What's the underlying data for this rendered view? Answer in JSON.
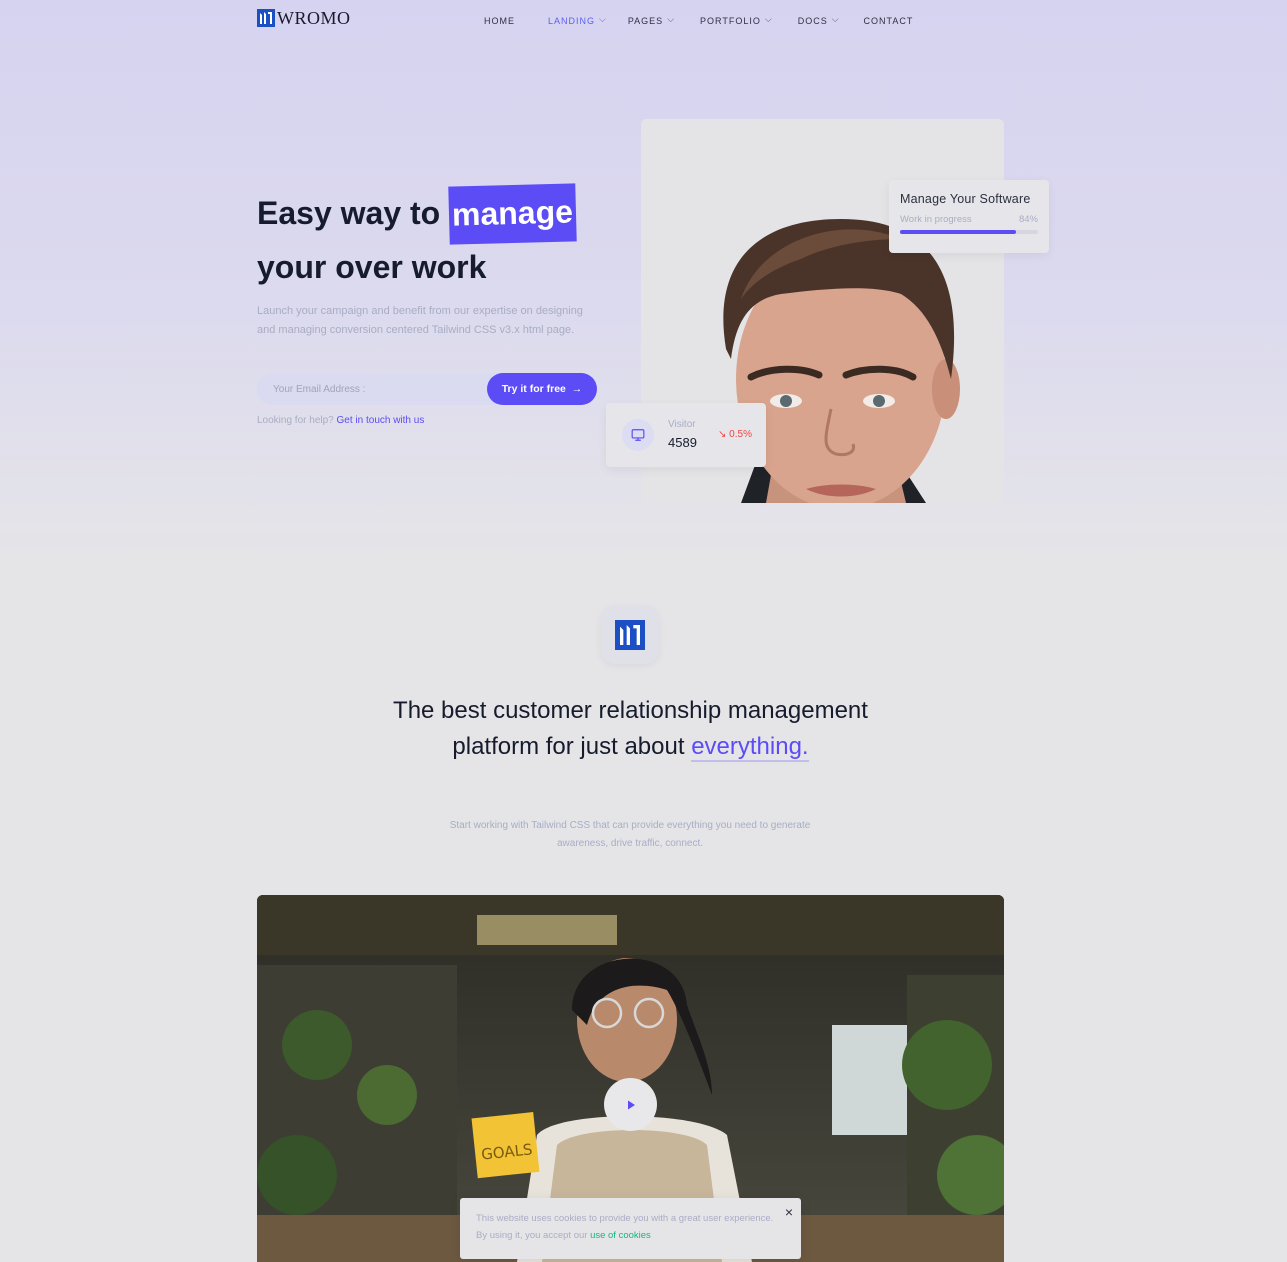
{
  "brand": {
    "name": "WROMO",
    "color": "#1d4fc4",
    "accent": "#5b4cf6"
  },
  "nav": [
    {
      "label": "HOME",
      "dropdown": false,
      "active": false
    },
    {
      "label": "LANDING",
      "dropdown": true,
      "active": true
    },
    {
      "label": "PAGES",
      "dropdown": true,
      "active": false
    },
    {
      "label": "PORTFOLIO",
      "dropdown": true,
      "active": false
    },
    {
      "label": "DOCS",
      "dropdown": true,
      "active": false
    },
    {
      "label": "CONTACT",
      "dropdown": false,
      "active": false
    }
  ],
  "hero": {
    "title_pre": "Easy way to",
    "title_highlight": "manage",
    "title_post": "your over work",
    "description": "Launch your campaign and benefit from our expertise on designing and managing conversion centered Tailwind CSS v3.x html page.",
    "email_placeholder": "Your Email Address :",
    "cta_label": "Try it for free",
    "cta_icon": "arrow-right-icon",
    "help_text": "Looking for help?",
    "help_link": "Get in touch with us"
  },
  "manage_card": {
    "title": "Manage Your Software",
    "status": "Work in progress",
    "percent_label": "84%",
    "progress": 0.84
  },
  "visitor_card": {
    "icon": "monitor-icon",
    "label": "Visitor",
    "value": "4589",
    "change": "0.5%",
    "trend_icon": "trending-down-icon",
    "trend_color": "#ef4444"
  },
  "section": {
    "title_pre": "The best customer relationship management platform for just about",
    "title_accent": "everything.",
    "description": "Start working with Tailwind CSS that can provide everything you need to generate awareness, drive traffic, connect."
  },
  "video": {
    "play_icon": "play-icon"
  },
  "cookie": {
    "text": "This website uses cookies to provide you with a great user experience. By using it, you accept our",
    "link": "use of cookies",
    "close_icon": "close-icon"
  }
}
